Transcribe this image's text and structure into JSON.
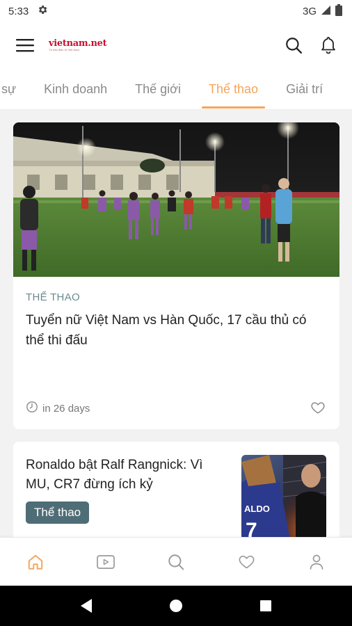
{
  "status_bar": {
    "time": "5:33",
    "network": "3G",
    "gear_icon": "gear-icon",
    "signal_icon": "signal-icon",
    "battery_icon": "battery-icon"
  },
  "app_bar": {
    "logo_text": "vietnam.net",
    "logo_tagline": "Tờ báo điện tử Việt Nam",
    "menu_icon": "hamburger-menu-icon",
    "search_icon": "search-icon",
    "bell_icon": "bell-icon"
  },
  "tabs": [
    {
      "label": "sự",
      "active": false
    },
    {
      "label": "Kinh doanh",
      "active": false
    },
    {
      "label": "Thế giới",
      "active": false
    },
    {
      "label": "Thể thao",
      "active": true
    },
    {
      "label": "Giải trí",
      "active": false
    }
  ],
  "featured": {
    "category": "THỂ THAO",
    "title": "Tuyển nữ Việt Nam vs Hàn Quốc, 17 cầu thủ có thể thi đấu",
    "time": "in 26 days",
    "image_desc": "football-training-night-photo"
  },
  "second": {
    "title": "Ronaldo bật Ralf Rangnick: Vì MU, CR7 đừng ích kỷ",
    "tag": "Thể thao",
    "thumb_desc": "ronaldo-thumbnail"
  },
  "bottom_nav": [
    {
      "name": "home-icon",
      "active": true
    },
    {
      "name": "video-icon",
      "active": false
    },
    {
      "name": "search-icon",
      "active": false
    },
    {
      "name": "heart-icon",
      "active": false
    },
    {
      "name": "profile-icon",
      "active": false
    }
  ],
  "colors": {
    "accent": "#f5a55a",
    "tag_bg": "#4f6d76",
    "category": "#6b8a8f",
    "icon_gray": "#9a9a9a"
  }
}
